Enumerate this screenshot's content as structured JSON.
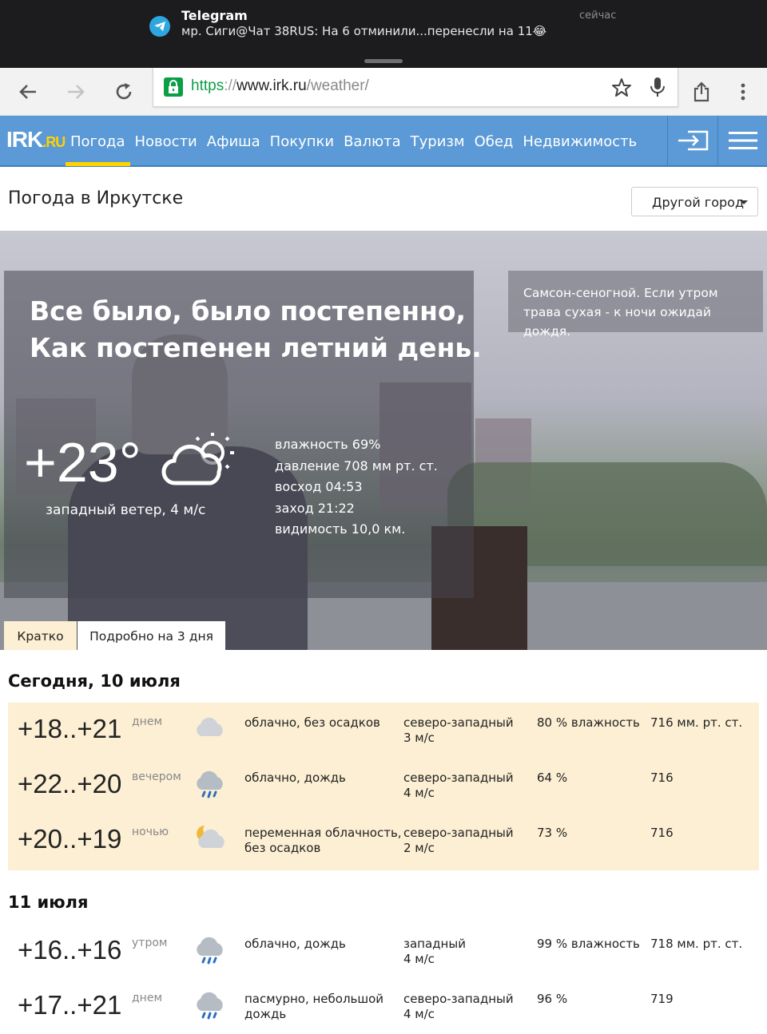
{
  "notification": {
    "app": "Telegram",
    "message": "мр. Сиги@Чат 38RUS: На 6 отминили...перенесли на 11😂",
    "time": "сейчас"
  },
  "browser": {
    "url_proto": "https",
    "url_sep": "://",
    "url_host": "www.irk.ru",
    "url_path": "/weather/"
  },
  "site": {
    "logo_main": "IRK",
    "logo_ru": ".RU",
    "menu": [
      "Погода",
      "Новости",
      "Афиша",
      "Покупки",
      "Валюта",
      "Туризм",
      "Обед",
      "Недвижимость"
    ]
  },
  "page": {
    "title": "Погода в Иркутске",
    "city_button": "Другой город"
  },
  "hero": {
    "quote_line1": "Все было, было постепенно,",
    "quote_line2": "Как постепенен летний день.",
    "temperature": "+23°",
    "wind": "западный ветер, 4 м/с",
    "stats": [
      "влажность 69%",
      "давление 708 мм рт. ст.",
      "восход 04:53",
      "заход 21:22",
      "видимость 10,0 км."
    ],
    "omen": "Самсон-сеногной. Если утром трава сухая - к ночи ожидай дождя.",
    "tab_short": "Кратко",
    "tab_detail": "Подробно на 3 дня"
  },
  "forecast": {
    "today_title": "Сегодня, 10 июля",
    "today": [
      {
        "temp": "+18..+21",
        "period": "днем",
        "icon": "cloud-icon",
        "desc1": "облачно, без осадков",
        "desc2": "",
        "wind1": "северо-западный",
        "wind2": "3 м/с",
        "hum": "80 % влажность",
        "pres": "716 мм. рт. ст."
      },
      {
        "temp": "+22..+20",
        "period": "вечером",
        "icon": "cloud-rain-icon",
        "desc1": "облачно, дождь",
        "desc2": "",
        "wind1": "северо-западный",
        "wind2": "4 м/с",
        "hum": "64 %",
        "pres": "716"
      },
      {
        "temp": "+20..+19",
        "period": "ночью",
        "icon": "moon-cloud-icon",
        "desc1": "переменная облачность,",
        "desc2": "без осадков",
        "wind1": "северо-западный",
        "wind2": "2 м/с",
        "hum": "73 %",
        "pres": "716"
      }
    ],
    "next_title": "11 июля",
    "next": [
      {
        "temp": "+16..+16",
        "period": "утром",
        "icon": "cloud-rain-icon",
        "desc1": "облачно, дождь",
        "desc2": "",
        "wind1": "западный",
        "wind2": "4 м/с",
        "hum": "99 % влажность",
        "pres": "718 мм. рт. ст."
      },
      {
        "temp": "+17..+21",
        "period": "днем",
        "icon": "cloud-rain-icon",
        "desc1": "пасмурно, небольшой",
        "desc2": "дождь",
        "wind1": "северо-западный",
        "wind2": "4 м/с",
        "hum": "96 %",
        "pres": "719"
      }
    ]
  }
}
